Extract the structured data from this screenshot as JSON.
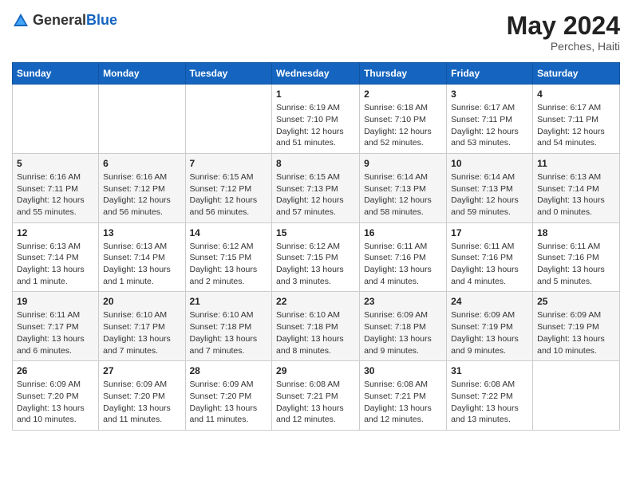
{
  "header": {
    "logo_general": "General",
    "logo_blue": "Blue",
    "month_year": "May 2024",
    "location": "Perches, Haiti"
  },
  "days_of_week": [
    "Sunday",
    "Monday",
    "Tuesday",
    "Wednesday",
    "Thursday",
    "Friday",
    "Saturday"
  ],
  "weeks": [
    [
      {
        "day": "",
        "sunrise": "",
        "sunset": "",
        "daylight": ""
      },
      {
        "day": "",
        "sunrise": "",
        "sunset": "",
        "daylight": ""
      },
      {
        "day": "",
        "sunrise": "",
        "sunset": "",
        "daylight": ""
      },
      {
        "day": "1",
        "sunrise": "Sunrise: 6:19 AM",
        "sunset": "Sunset: 7:10 PM",
        "daylight": "Daylight: 12 hours and 51 minutes."
      },
      {
        "day": "2",
        "sunrise": "Sunrise: 6:18 AM",
        "sunset": "Sunset: 7:10 PM",
        "daylight": "Daylight: 12 hours and 52 minutes."
      },
      {
        "day": "3",
        "sunrise": "Sunrise: 6:17 AM",
        "sunset": "Sunset: 7:11 PM",
        "daylight": "Daylight: 12 hours and 53 minutes."
      },
      {
        "day": "4",
        "sunrise": "Sunrise: 6:17 AM",
        "sunset": "Sunset: 7:11 PM",
        "daylight": "Daylight: 12 hours and 54 minutes."
      }
    ],
    [
      {
        "day": "5",
        "sunrise": "Sunrise: 6:16 AM",
        "sunset": "Sunset: 7:11 PM",
        "daylight": "Daylight: 12 hours and 55 minutes."
      },
      {
        "day": "6",
        "sunrise": "Sunrise: 6:16 AM",
        "sunset": "Sunset: 7:12 PM",
        "daylight": "Daylight: 12 hours and 56 minutes."
      },
      {
        "day": "7",
        "sunrise": "Sunrise: 6:15 AM",
        "sunset": "Sunset: 7:12 PM",
        "daylight": "Daylight: 12 hours and 56 minutes."
      },
      {
        "day": "8",
        "sunrise": "Sunrise: 6:15 AM",
        "sunset": "Sunset: 7:13 PM",
        "daylight": "Daylight: 12 hours and 57 minutes."
      },
      {
        "day": "9",
        "sunrise": "Sunrise: 6:14 AM",
        "sunset": "Sunset: 7:13 PM",
        "daylight": "Daylight: 12 hours and 58 minutes."
      },
      {
        "day": "10",
        "sunrise": "Sunrise: 6:14 AM",
        "sunset": "Sunset: 7:13 PM",
        "daylight": "Daylight: 12 hours and 59 minutes."
      },
      {
        "day": "11",
        "sunrise": "Sunrise: 6:13 AM",
        "sunset": "Sunset: 7:14 PM",
        "daylight": "Daylight: 13 hours and 0 minutes."
      }
    ],
    [
      {
        "day": "12",
        "sunrise": "Sunrise: 6:13 AM",
        "sunset": "Sunset: 7:14 PM",
        "daylight": "Daylight: 13 hours and 1 minute."
      },
      {
        "day": "13",
        "sunrise": "Sunrise: 6:13 AM",
        "sunset": "Sunset: 7:14 PM",
        "daylight": "Daylight: 13 hours and 1 minute."
      },
      {
        "day": "14",
        "sunrise": "Sunrise: 6:12 AM",
        "sunset": "Sunset: 7:15 PM",
        "daylight": "Daylight: 13 hours and 2 minutes."
      },
      {
        "day": "15",
        "sunrise": "Sunrise: 6:12 AM",
        "sunset": "Sunset: 7:15 PM",
        "daylight": "Daylight: 13 hours and 3 minutes."
      },
      {
        "day": "16",
        "sunrise": "Sunrise: 6:11 AM",
        "sunset": "Sunset: 7:16 PM",
        "daylight": "Daylight: 13 hours and 4 minutes."
      },
      {
        "day": "17",
        "sunrise": "Sunrise: 6:11 AM",
        "sunset": "Sunset: 7:16 PM",
        "daylight": "Daylight: 13 hours and 4 minutes."
      },
      {
        "day": "18",
        "sunrise": "Sunrise: 6:11 AM",
        "sunset": "Sunset: 7:16 PM",
        "daylight": "Daylight: 13 hours and 5 minutes."
      }
    ],
    [
      {
        "day": "19",
        "sunrise": "Sunrise: 6:11 AM",
        "sunset": "Sunset: 7:17 PM",
        "daylight": "Daylight: 13 hours and 6 minutes."
      },
      {
        "day": "20",
        "sunrise": "Sunrise: 6:10 AM",
        "sunset": "Sunset: 7:17 PM",
        "daylight": "Daylight: 13 hours and 7 minutes."
      },
      {
        "day": "21",
        "sunrise": "Sunrise: 6:10 AM",
        "sunset": "Sunset: 7:18 PM",
        "daylight": "Daylight: 13 hours and 7 minutes."
      },
      {
        "day": "22",
        "sunrise": "Sunrise: 6:10 AM",
        "sunset": "Sunset: 7:18 PM",
        "daylight": "Daylight: 13 hours and 8 minutes."
      },
      {
        "day": "23",
        "sunrise": "Sunrise: 6:09 AM",
        "sunset": "Sunset: 7:18 PM",
        "daylight": "Daylight: 13 hours and 9 minutes."
      },
      {
        "day": "24",
        "sunrise": "Sunrise: 6:09 AM",
        "sunset": "Sunset: 7:19 PM",
        "daylight": "Daylight: 13 hours and 9 minutes."
      },
      {
        "day": "25",
        "sunrise": "Sunrise: 6:09 AM",
        "sunset": "Sunset: 7:19 PM",
        "daylight": "Daylight: 13 hours and 10 minutes."
      }
    ],
    [
      {
        "day": "26",
        "sunrise": "Sunrise: 6:09 AM",
        "sunset": "Sunset: 7:20 PM",
        "daylight": "Daylight: 13 hours and 10 minutes."
      },
      {
        "day": "27",
        "sunrise": "Sunrise: 6:09 AM",
        "sunset": "Sunset: 7:20 PM",
        "daylight": "Daylight: 13 hours and 11 minutes."
      },
      {
        "day": "28",
        "sunrise": "Sunrise: 6:09 AM",
        "sunset": "Sunset: 7:20 PM",
        "daylight": "Daylight: 13 hours and 11 minutes."
      },
      {
        "day": "29",
        "sunrise": "Sunrise: 6:08 AM",
        "sunset": "Sunset: 7:21 PM",
        "daylight": "Daylight: 13 hours and 12 minutes."
      },
      {
        "day": "30",
        "sunrise": "Sunrise: 6:08 AM",
        "sunset": "Sunset: 7:21 PM",
        "daylight": "Daylight: 13 hours and 12 minutes."
      },
      {
        "day": "31",
        "sunrise": "Sunrise: 6:08 AM",
        "sunset": "Sunset: 7:22 PM",
        "daylight": "Daylight: 13 hours and 13 minutes."
      },
      {
        "day": "",
        "sunrise": "",
        "sunset": "",
        "daylight": ""
      }
    ]
  ]
}
